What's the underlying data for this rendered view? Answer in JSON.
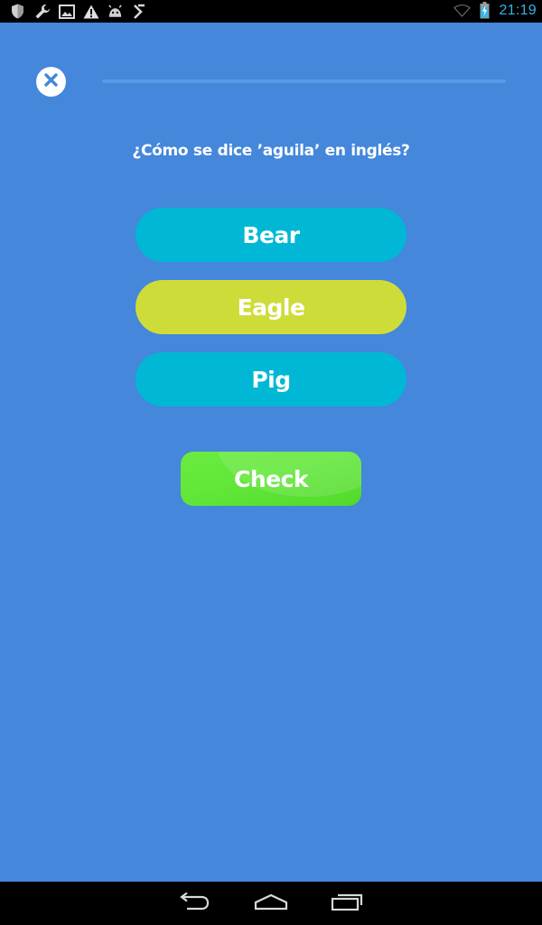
{
  "status_bar": {
    "time": "21:19",
    "left_icons": [
      "shield-icon",
      "wrench-icon",
      "image-icon",
      "warning-icon",
      "android-icon",
      "download-icon"
    ],
    "right_icons": [
      "wifi-icon",
      "battery-charging-icon"
    ]
  },
  "lesson": {
    "progress": 0.0,
    "question": "¿Cómo se dice ’aguila’ en inglés?"
  },
  "options": [
    {
      "label": "Bear",
      "selected": false
    },
    {
      "label": "Eagle",
      "selected": true
    },
    {
      "label": "Pig",
      "selected": false
    }
  ],
  "check_button": {
    "label": "Check"
  },
  "navigation": {
    "buttons": [
      "back-icon",
      "home-icon",
      "recents-icon"
    ]
  },
  "colors": {
    "background": "#4487db",
    "option": "#00b8d5",
    "option_selected": "#cedc39",
    "check": "#5fe538",
    "clock": "#2fb4e9"
  }
}
